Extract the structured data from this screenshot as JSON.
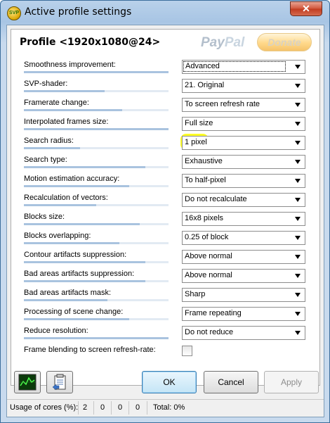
{
  "window": {
    "title": "Active profile settings",
    "close_glyph": "✕",
    "icon_text": "SVP"
  },
  "header": {
    "profile": "Profile <1920x1080@24>",
    "paypal_a": "Pay",
    "paypal_b": "Pal",
    "donate": "Donate"
  },
  "settings": [
    {
      "label": "Smoothness improvement:",
      "value": "Advanced",
      "level": 1.0
    },
    {
      "label": "SVP-shader:",
      "value": "21. Original",
      "level": 0.56
    },
    {
      "label": "Framerate change:",
      "value": "To screen refresh rate",
      "level": 0.68
    },
    {
      "label": "Interpolated frames size:",
      "value": "Full size",
      "level": 1.0
    },
    {
      "label": "Search radius:",
      "value": "1 pixel",
      "level": 0.39
    },
    {
      "label": "Search type:",
      "value": "Exhaustive",
      "level": 0.84
    },
    {
      "label": "Motion estimation accuracy:",
      "value": "To half-pixel",
      "level": 0.73
    },
    {
      "label": "Recalculation of vectors:",
      "value": "Do not recalculate",
      "level": 0.5
    },
    {
      "label": "Blocks size:",
      "value": "16x8 pixels",
      "level": 0.8
    },
    {
      "label": "Blocks overlapping:",
      "value": "0.25 of block",
      "level": 0.66
    },
    {
      "label": "Contour artifacts suppression:",
      "value": "Above normal",
      "level": 0.84
    },
    {
      "label": "Bad areas artifacts suppression:",
      "value": "Above normal",
      "level": 0.84
    },
    {
      "label": "Bad areas artifacts mask:",
      "value": "Sharp",
      "level": 0.58
    },
    {
      "label": "Processing of scene change:",
      "value": "Frame repeating",
      "level": 0.73
    },
    {
      "label": "Reduce resolution:",
      "value": "Do not reduce",
      "level": 1.0
    }
  ],
  "frame_blending": {
    "label": "Frame blending to screen refresh-rate:",
    "checked": false
  },
  "buttons": {
    "ok": "OK",
    "cancel": "Cancel",
    "apply": "Apply"
  },
  "status": {
    "cores_label": "Usage of cores (%):",
    "c1": "2",
    "c2": "0",
    "c3": "0",
    "c4": "0",
    "total": "Total: 0%"
  },
  "colors": {
    "highlight": "#ffff00",
    "bar_fill": "#a9c3df"
  }
}
